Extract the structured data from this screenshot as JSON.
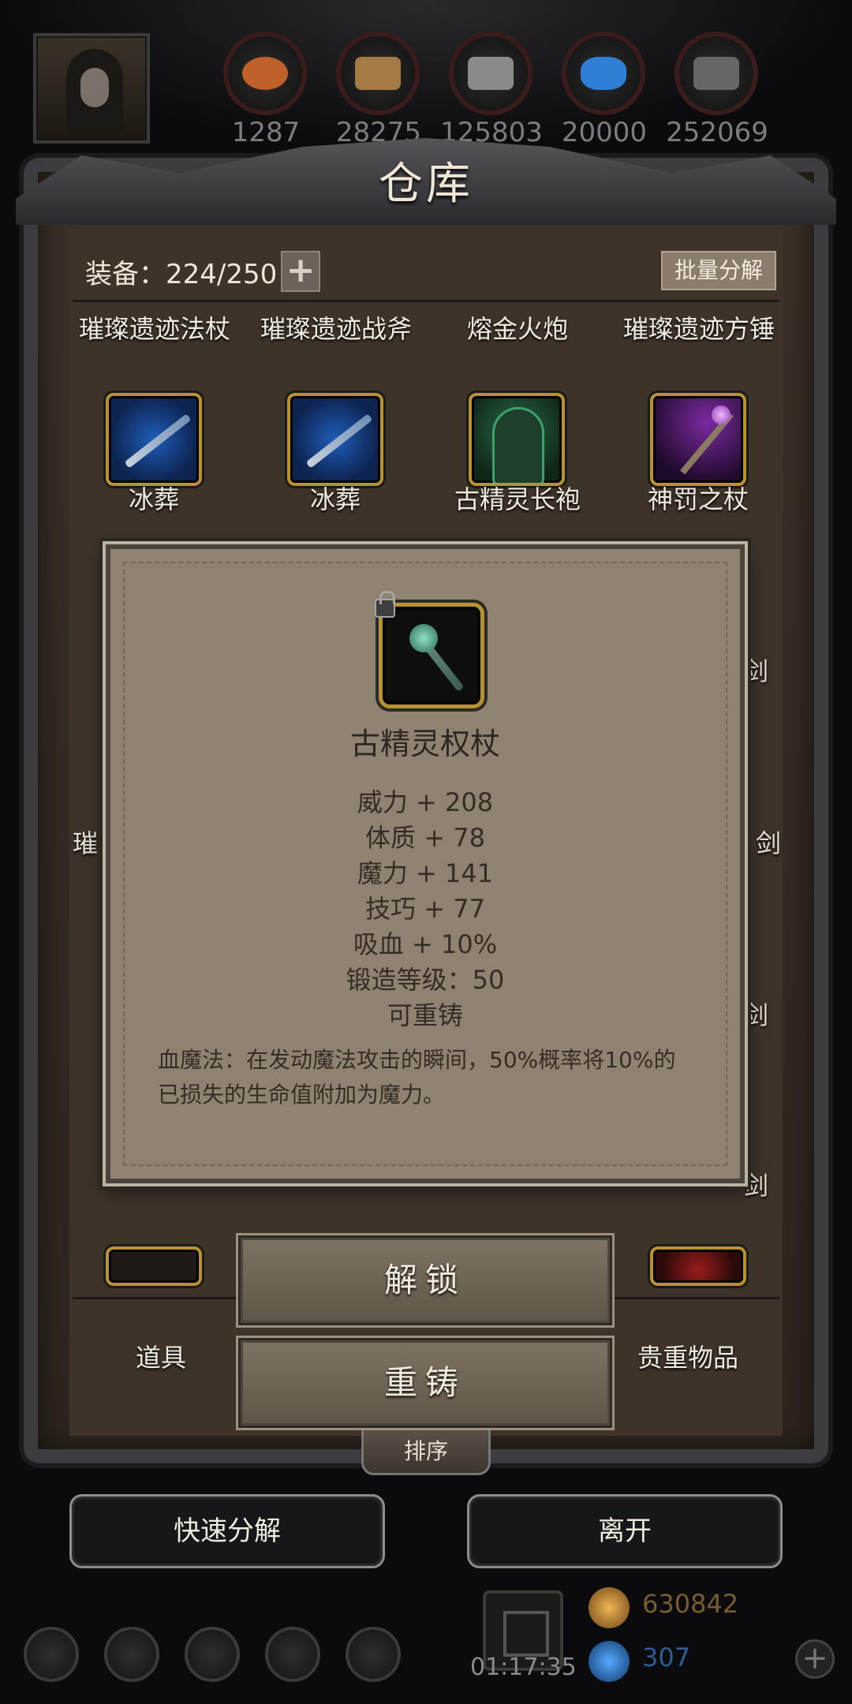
{
  "topbar": {
    "resources": [
      {
        "icon": "ore-orange-icon",
        "count": "1287",
        "color": "#c0602a"
      },
      {
        "icon": "wood-planks-icon",
        "count": "28275",
        "color": "#a57a45"
      },
      {
        "icon": "iron-ingot-icon",
        "count": "125803",
        "color": "#8a8a8a"
      },
      {
        "icon": "blue-crystal-icon",
        "count": "20000",
        "color": "#2f7fd6"
      },
      {
        "icon": "dark-stone-icon",
        "count": "252069",
        "color": "#666666"
      }
    ]
  },
  "warehouse": {
    "title": "仓库",
    "equip_count": "装备：224/250",
    "batch_label": "批量分解",
    "row1_names": [
      "璀璨遗迹法杖",
      "璀璨遗迹战斧",
      "熔金火炮",
      "璀璨遗迹方锤"
    ],
    "row2_items": [
      "冰葬",
      "冰葬",
      "古精灵长袍",
      "神罚之杖"
    ],
    "peek": {
      "right1": "剑",
      "left2": "璀",
      "right2": "剑",
      "right3": "剑",
      "right4": "剑"
    }
  },
  "tooltip": {
    "name": "古精灵权杖",
    "stats": [
      "威力 + 208",
      "体质 + 78",
      "魔力 + 141",
      "技巧 + 77",
      "吸血 + 10%",
      "锻造等级：50",
      "可重铸"
    ],
    "description": "血魔法：在发动魔法攻击的瞬间，50%概率将10%的已损失的生命值附加为魔力。"
  },
  "actions": {
    "unlock": "解锁",
    "reforge": "重铸"
  },
  "tabs": {
    "items": "道具",
    "valuables": "贵重物品",
    "sort": "排序"
  },
  "buttons": {
    "quick_decompose": "快速分解",
    "leave": "离开"
  },
  "hud": {
    "timer": "01:17:35",
    "gold": "630842",
    "gems": "307"
  }
}
